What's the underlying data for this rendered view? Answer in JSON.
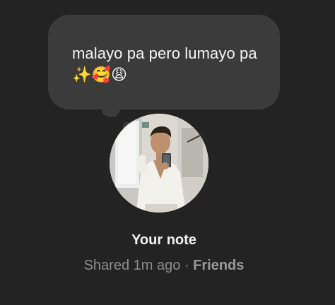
{
  "note": {
    "text": "malayo pa pero lumayo pa ✨🥰😩"
  },
  "owner": {
    "label": "Your note"
  },
  "meta": {
    "shared": "Shared 1m ago",
    "separator": " · ",
    "audience": "Friends"
  },
  "colors": {
    "background": "#232323",
    "bubble": "#3b3b3b",
    "primary_text": "#f2f2f2",
    "secondary_text": "#8c8c8c"
  }
}
